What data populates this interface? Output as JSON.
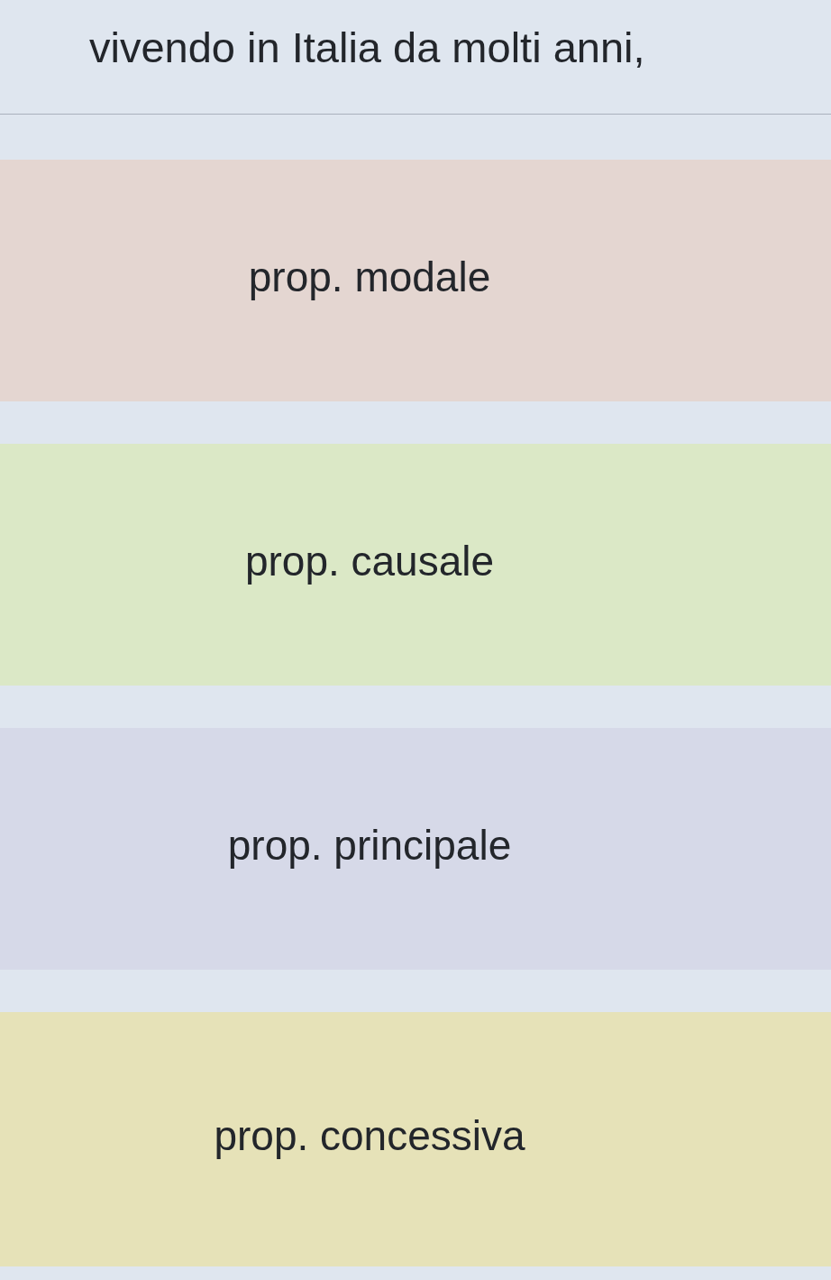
{
  "sentence": "vivendo in Italia da molti anni,",
  "options": [
    {
      "label": "prop. modale",
      "color": "#e4d6d1"
    },
    {
      "label": "prop. causale",
      "color": "#dbe8c6"
    },
    {
      "label": "prop. principale",
      "color": "#d6d9e8"
    },
    {
      "label": "prop. concessiva",
      "color": "#e6e2b8"
    }
  ]
}
